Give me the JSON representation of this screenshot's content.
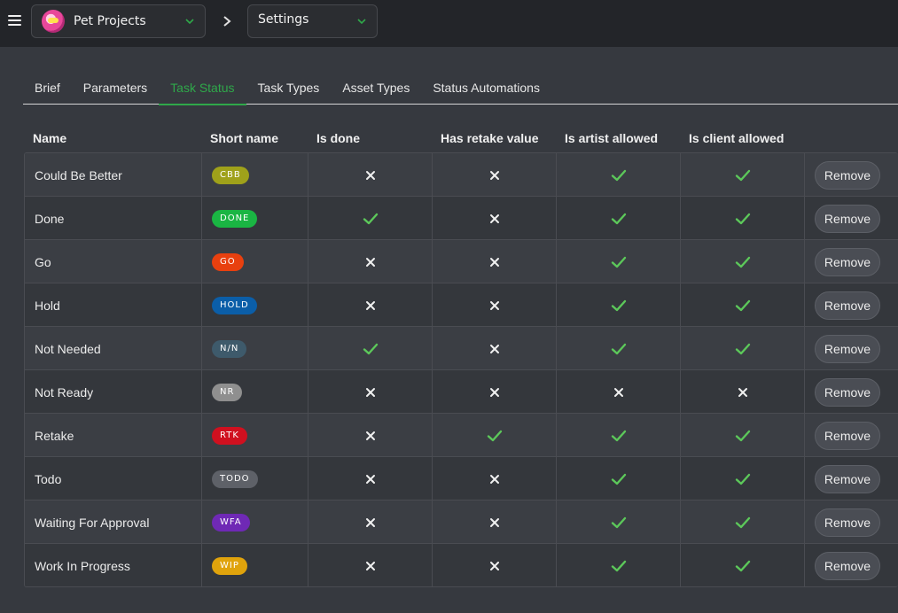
{
  "header": {
    "project_name": "Pet Projects",
    "section_name": "Settings"
  },
  "tabs": [
    {
      "label": "Brief",
      "active": false
    },
    {
      "label": "Parameters",
      "active": false
    },
    {
      "label": "Task Status",
      "active": true
    },
    {
      "label": "Task Types",
      "active": false
    },
    {
      "label": "Asset Types",
      "active": false
    },
    {
      "label": "Status Automations",
      "active": false
    }
  ],
  "table": {
    "columns": [
      "Name",
      "Short name",
      "Is done",
      "Has retake value",
      "Is artist allowed",
      "Is client allowed"
    ],
    "remove_label": "Remove",
    "rows": [
      {
        "name": "Could Be Better",
        "short": "CBB",
        "color": "#9fa11a",
        "is_done": false,
        "retake": false,
        "artist": true,
        "client": true
      },
      {
        "name": "Done",
        "short": "DONE",
        "color": "#1ab543",
        "is_done": true,
        "retake": false,
        "artist": true,
        "client": true
      },
      {
        "name": "Go",
        "short": "GO",
        "color": "#e8400f",
        "is_done": false,
        "retake": false,
        "artist": true,
        "client": true
      },
      {
        "name": "Hold",
        "short": "HOLD",
        "color": "#0b5ea8",
        "is_done": false,
        "retake": false,
        "artist": true,
        "client": true
      },
      {
        "name": "Not Needed",
        "short": "N/N",
        "color": "#3e5a6b",
        "is_done": true,
        "retake": false,
        "artist": true,
        "client": true
      },
      {
        "name": "Not Ready",
        "short": "NR",
        "color": "#8f8f8f",
        "is_done": false,
        "retake": false,
        "artist": false,
        "client": false
      },
      {
        "name": "Retake",
        "short": "RTK",
        "color": "#d0101f",
        "is_done": false,
        "retake": true,
        "artist": true,
        "client": true
      },
      {
        "name": "Todo",
        "short": "TODO",
        "color": "#5e6168",
        "is_done": false,
        "retake": false,
        "artist": true,
        "client": true
      },
      {
        "name": "Waiting For Approval",
        "short": "WFA",
        "color": "#6f29b5",
        "is_done": false,
        "retake": false,
        "artist": true,
        "client": true
      },
      {
        "name": "Work In Progress",
        "short": "WIP",
        "color": "#e0a30c",
        "is_done": false,
        "retake": false,
        "artist": true,
        "client": true
      }
    ]
  },
  "colors": {
    "accent": "#2fa84a",
    "check": "#5cc85a",
    "cross": "#f0f0f0"
  }
}
